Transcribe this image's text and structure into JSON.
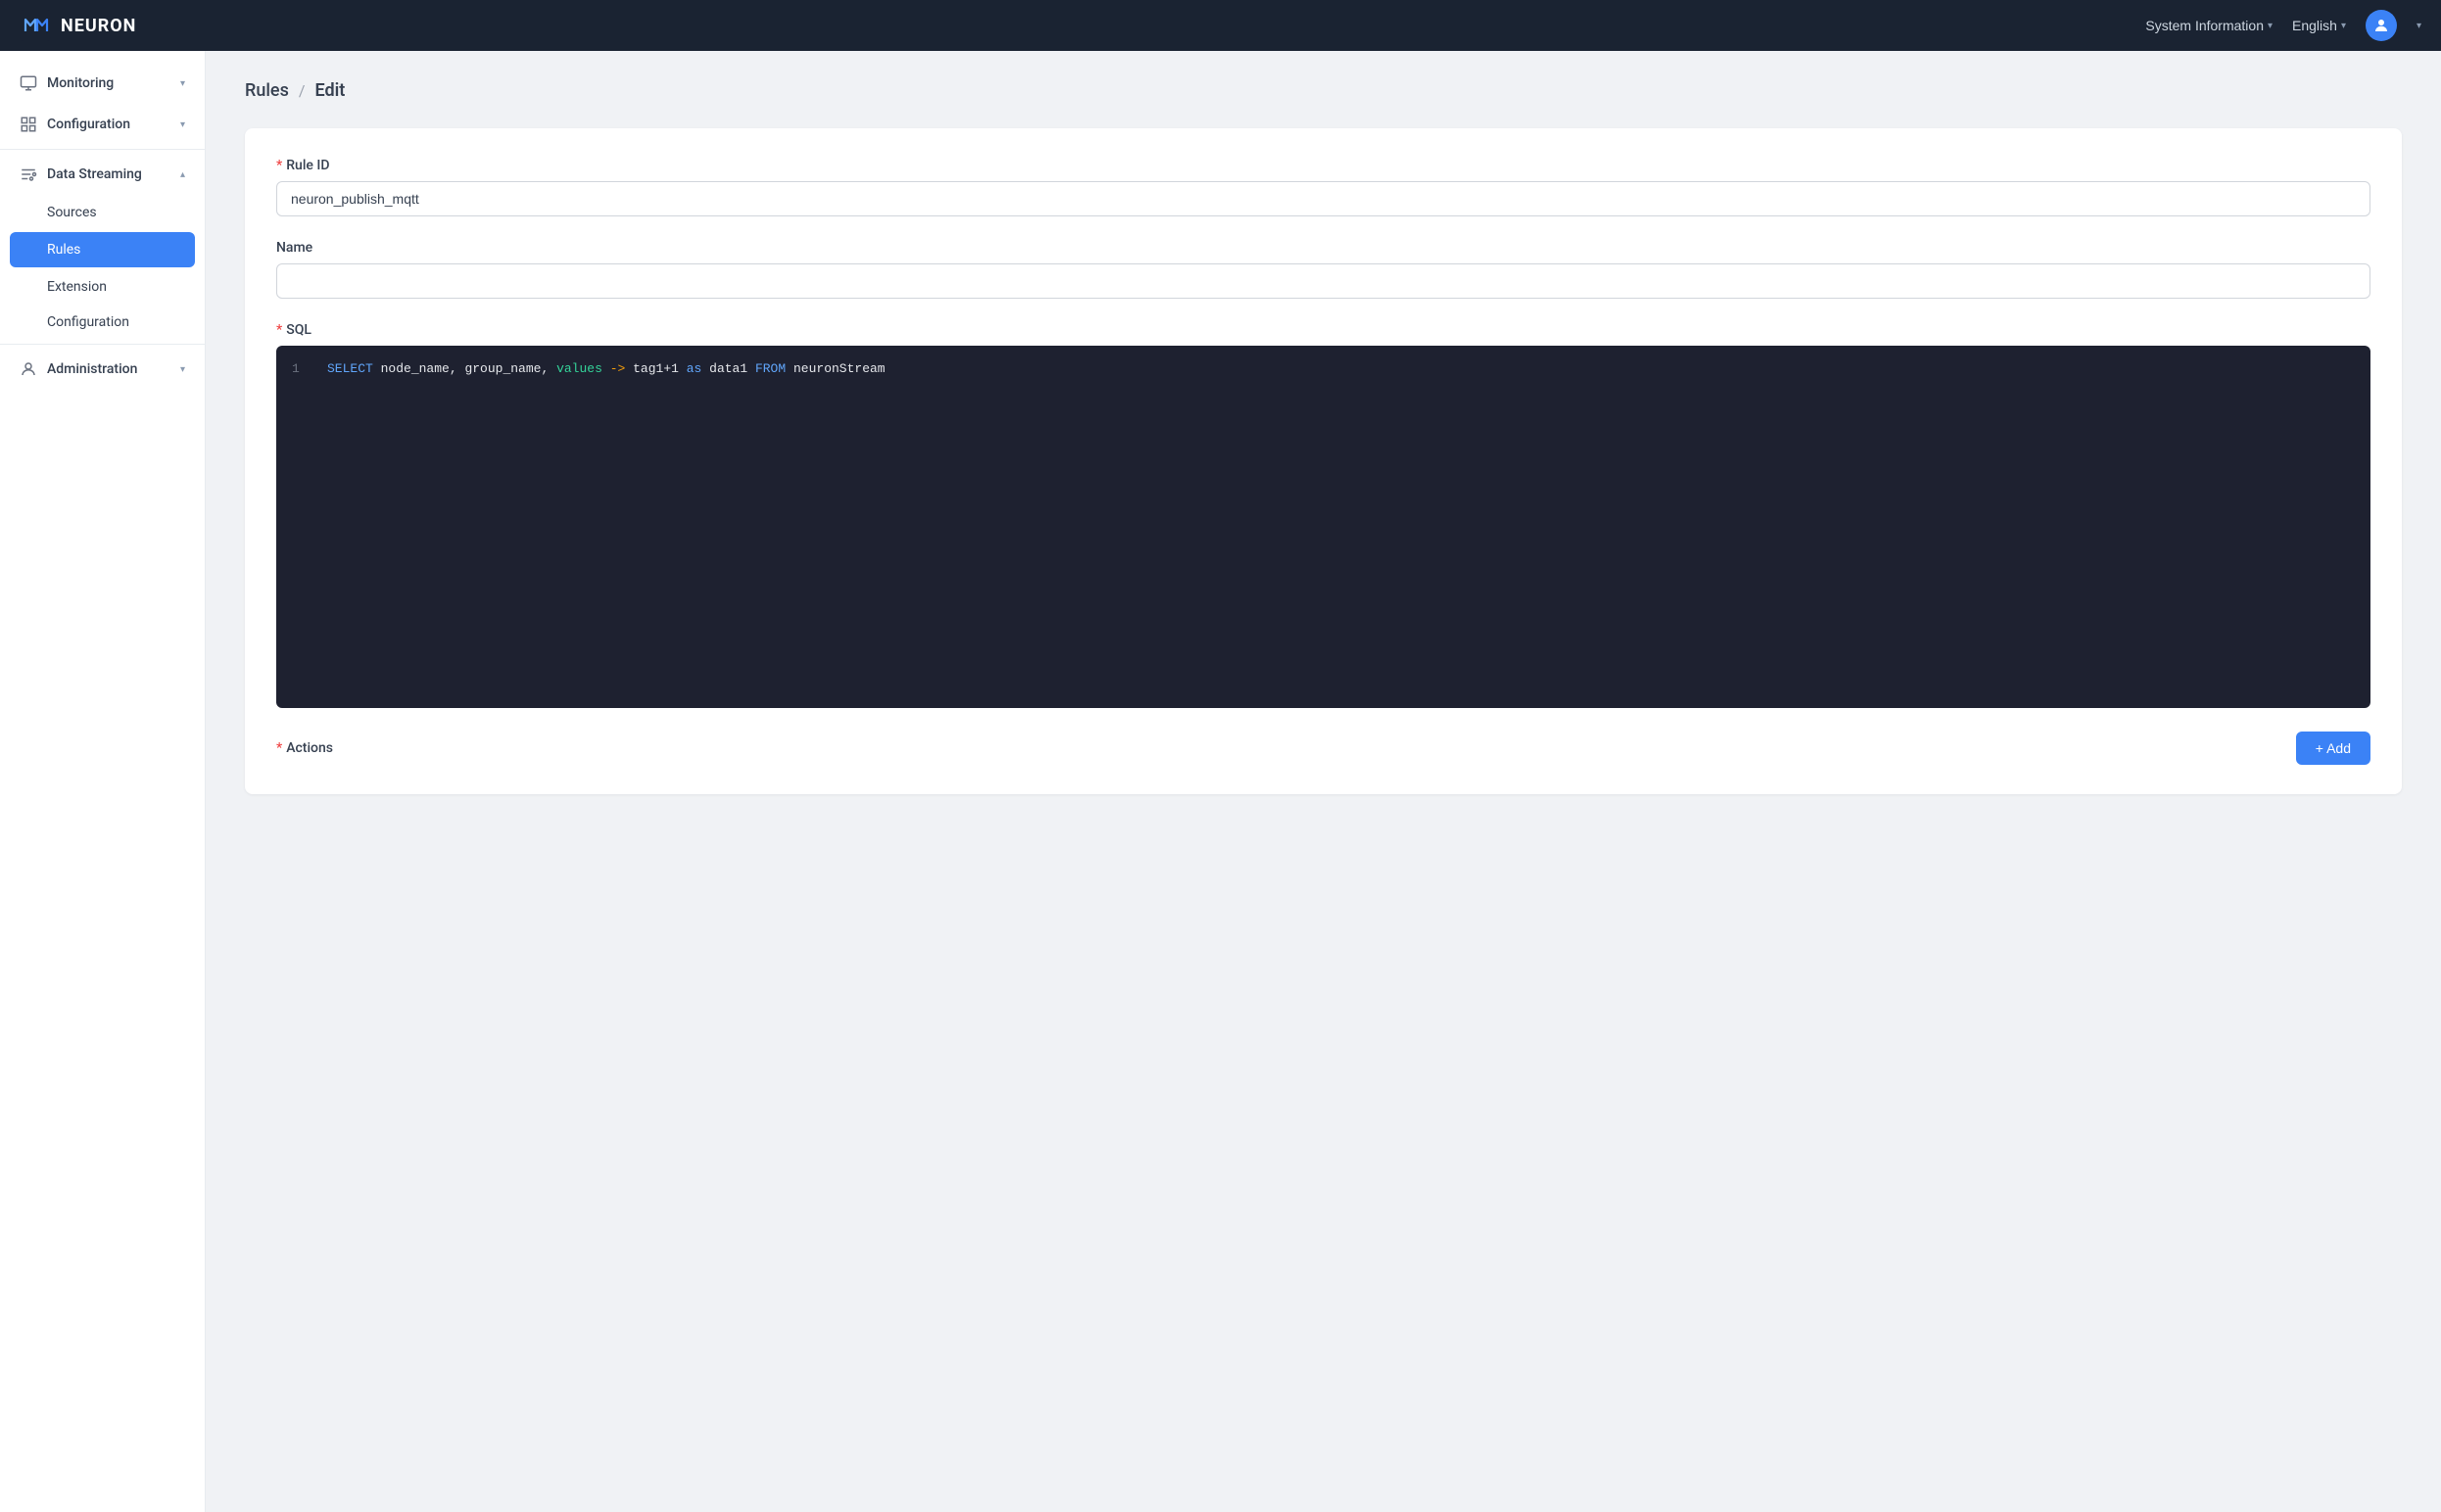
{
  "header": {
    "logo_text": "NEURON",
    "system_info_label": "System Information",
    "language_label": "English",
    "user_icon": "👤"
  },
  "sidebar": {
    "items": [
      {
        "id": "monitoring",
        "label": "Monitoring",
        "icon": "monitor",
        "expandable": true
      },
      {
        "id": "configuration",
        "label": "Configuration",
        "icon": "grid",
        "expandable": true
      },
      {
        "id": "data-streaming",
        "label": "Data Streaming",
        "icon": "stream",
        "expandable": true,
        "expanded": true
      },
      {
        "id": "sources",
        "label": "Sources",
        "sub": true
      },
      {
        "id": "rules",
        "label": "Rules",
        "sub": true,
        "active": true
      },
      {
        "id": "extension",
        "label": "Extension",
        "sub": true
      },
      {
        "id": "configuration-sub",
        "label": "Configuration",
        "sub": true
      },
      {
        "id": "administration",
        "label": "Administration",
        "icon": "user",
        "expandable": true
      }
    ]
  },
  "breadcrumb": {
    "parent": "Rules",
    "separator": "/",
    "current": "Edit"
  },
  "form": {
    "rule_id_label": "Rule ID",
    "rule_id_required": true,
    "rule_id_value": "neuron_publish_mqtt",
    "name_label": "Name",
    "name_required": false,
    "name_value": "",
    "name_placeholder": "",
    "sql_label": "SQL",
    "sql_required": true,
    "sql_line_number": "1",
    "sql_content": "SELECT node_name, group_name, values->tag1+1 as data1 FROM neuronStream",
    "actions_label": "Actions",
    "actions_required": true,
    "add_button_label": "+ Add"
  }
}
